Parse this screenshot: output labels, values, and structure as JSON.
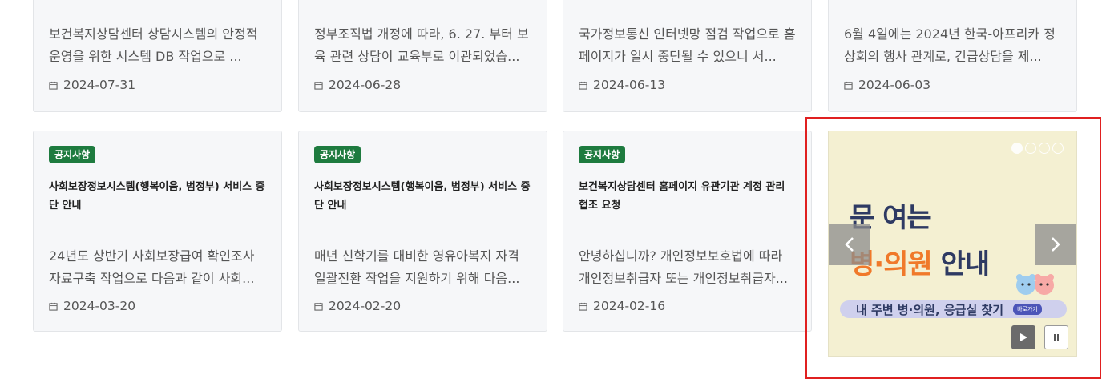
{
  "top_cards": [
    {
      "summary": "보건복지상담센터 상담시스템의 안정적 운영을 위한 시스템 DB 작업으로 ...",
      "date": "2024-07-31"
    },
    {
      "summary": "정부조직법 개정에 따라, 6. 27. 부터 보육 관련 상담이 교육부로 이관되었습...",
      "date": "2024-06-28"
    },
    {
      "summary": "국가정보통신 인터넷망 점검 작업으로 홈페이지가 일시 중단될 수 있으니 서...",
      "date": "2024-06-13"
    },
    {
      "summary": "6월 4일에는 2024년 한국-아프리카 정상회의 행사 관계로, 긴급상담을 제...",
      "date": "2024-06-03"
    }
  ],
  "bottom_cards": [
    {
      "badge": "공지사항",
      "title": "사회보장정보시스템(행복이음, 범정부) 서비스 중단 안내",
      "summary": "24년도 상반기 사회보장급여 확인조사 자료구축 작업으로 다음과 같이 사회...",
      "date": "2024-03-20"
    },
    {
      "badge": "공지사항",
      "title": "사회보장정보시스템(행복이음, 범정부) 서비스 중단 안내",
      "summary": "매년 신학기를 대비한 영유아복지 자격 일괄전환 작업을 지원하기 위해 다음...",
      "date": "2024-02-20"
    },
    {
      "badge": "공지사항",
      "title": "보건복지상담센터 홈페이지 유관기관 계정 관리 협조 요청",
      "summary": "안녕하십니까? 개인정보보호법에 따라 개인정보취급자 또는 개인정보취급자...",
      "date": "2024-02-16"
    }
  ],
  "banner": {
    "line1": "문 여는",
    "line2_orange": "병·의원",
    "line2_rest": " 안내",
    "pill_text": "내 주변 병·의원, 응급실 찾기",
    "pill_button": "바로가기",
    "slide_count": 4,
    "active_slide": 1,
    "colors": {
      "background": "#f4f0d2",
      "title": "#2e3a63",
      "accent": "#f0792a",
      "pill": "#cfd0ed"
    }
  },
  "icons": {
    "date": "calendar-icon",
    "prev": "chevron-left-icon",
    "next": "chevron-right-icon",
    "play": "play-icon",
    "pause": "pause-icon"
  },
  "colors": {
    "badge": "#1e7b3f",
    "highlight_border": "#e02020",
    "card_bg": "#f6f7f9"
  }
}
